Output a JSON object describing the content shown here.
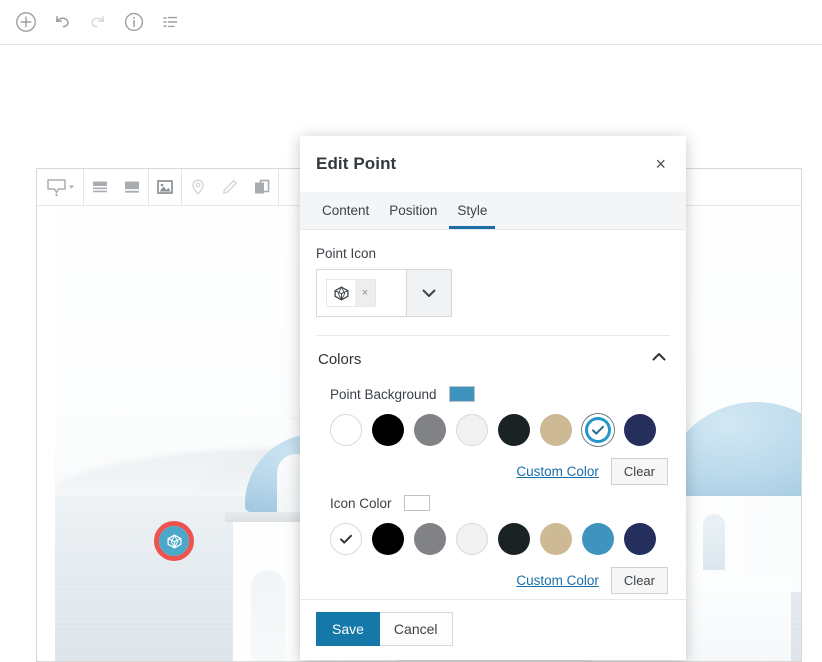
{
  "app_toolbar": {
    "items": [
      {
        "name": "add-circle-icon",
        "label": "Add"
      },
      {
        "name": "undo-icon",
        "label": "Undo"
      },
      {
        "name": "redo-icon",
        "label": "Redo"
      },
      {
        "name": "info-circle-icon",
        "label": "Info"
      },
      {
        "name": "list-icon",
        "label": "List"
      }
    ]
  },
  "editor_toolbar": {
    "items": [
      {
        "name": "tooltip-icon",
        "label": "Tooltip"
      },
      {
        "name": "tooltip-dropdown-caret",
        "label": "Tooltip options"
      },
      {
        "name": "layout-split-icon",
        "label": "Split layout"
      },
      {
        "name": "layout-bottom-icon",
        "label": "Bottom layout"
      },
      {
        "name": "image-icon",
        "label": "Image"
      },
      {
        "name": "pin-icon",
        "label": "Add point"
      },
      {
        "name": "pencil-icon",
        "label": "Draw"
      },
      {
        "name": "layers-icon",
        "label": "Layers"
      }
    ]
  },
  "canvas": {
    "marker": {
      "icon": "cube-icon",
      "background_color": "#4ba8c9",
      "icon_color": "#ffffff",
      "selection_ring_color": "#ef5350"
    }
  },
  "dialog": {
    "title": "Edit Point",
    "close_label": "×",
    "tabs": [
      {
        "label": "Content",
        "active": false
      },
      {
        "label": "Position",
        "active": false
      },
      {
        "label": "Style",
        "active": true
      }
    ],
    "point_icon": {
      "label": "Point Icon",
      "selected_icon": "cube-icon",
      "remove_label": "×",
      "dropdown_icon": "chevron-down-icon"
    },
    "colors_section": {
      "title": "Colors",
      "collapse_icon": "chevron-up-icon",
      "groups": [
        {
          "label": "Point Background",
          "preview_color": "#3f93bf",
          "swatches": [
            {
              "color": "#ffffff",
              "selected": false,
              "bordered": true
            },
            {
              "color": "#000000",
              "selected": false,
              "bordered": false
            },
            {
              "color": "#808285",
              "selected": false,
              "bordered": false
            },
            {
              "color": "#f2f2f2",
              "selected": false,
              "bordered": true
            },
            {
              "color": "#1a2224",
              "selected": false,
              "bordered": false
            },
            {
              "color": "#cdb993",
              "selected": false,
              "bordered": false
            },
            {
              "color": "#3f93bf",
              "selected": true,
              "bordered": false
            },
            {
              "color": "#252f5e",
              "selected": false,
              "bordered": false
            }
          ],
          "custom_color_label": "Custom Color",
          "clear_label": "Clear"
        },
        {
          "label": "Icon Color",
          "preview_color": "#ffffff",
          "swatches": [
            {
              "color": "#ffffff",
              "selected": true,
              "bordered": true
            },
            {
              "color": "#000000",
              "selected": false,
              "bordered": false
            },
            {
              "color": "#808285",
              "selected": false,
              "bordered": false
            },
            {
              "color": "#f2f2f2",
              "selected": false,
              "bordered": true
            },
            {
              "color": "#1a2224",
              "selected": false,
              "bordered": false
            },
            {
              "color": "#cdb993",
              "selected": false,
              "bordered": false
            },
            {
              "color": "#3f93bf",
              "selected": false,
              "bordered": false
            },
            {
              "color": "#252f5e",
              "selected": false,
              "bordered": false
            }
          ],
          "custom_color_label": "Custom Color",
          "clear_label": "Clear"
        }
      ]
    },
    "footer": {
      "save_label": "Save",
      "cancel_label": "Cancel"
    }
  },
  "theme": {
    "accent": "#1478a8",
    "tab_underline": "#1a6ea8",
    "link": "#1a6ea8"
  }
}
